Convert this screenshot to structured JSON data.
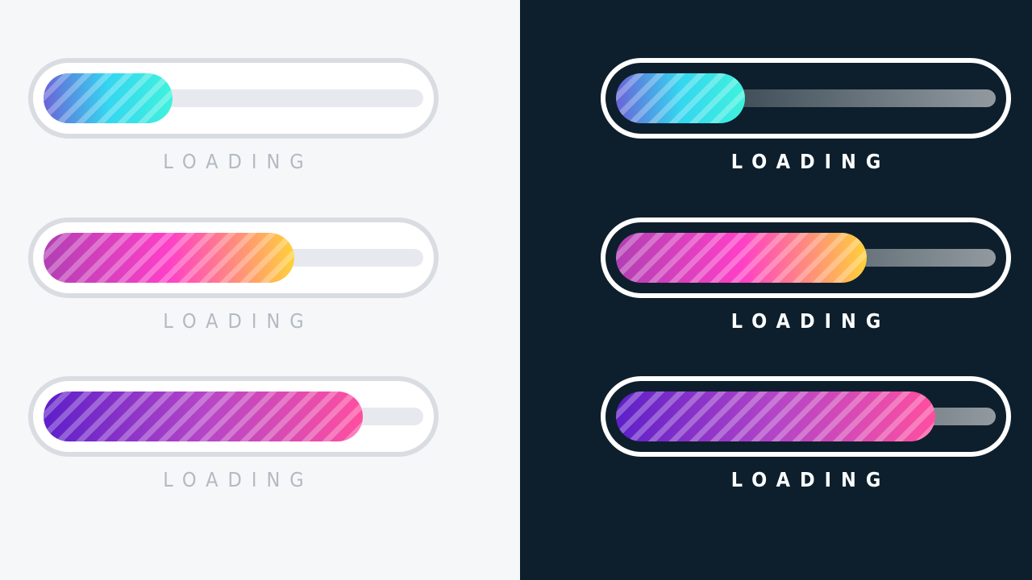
{
  "colors": {
    "light_background": "#f6f7f9",
    "dark_background": "#0d1f2c"
  },
  "panels": [
    {
      "theme": "light",
      "loaders": [
        {
          "label": "LOADING",
          "progress": 0.34,
          "gradient": [
            "#6a63d8",
            "#34d6f0",
            "#3ff2dc"
          ]
        },
        {
          "label": "LOADING",
          "progress": 0.66,
          "gradient": [
            "#b13fb3",
            "#ff3fc8",
            "#ffd13a"
          ]
        },
        {
          "label": "LOADING",
          "progress": 0.84,
          "gradient": [
            "#5d1fc9",
            "#b445c7",
            "#ff4fa0"
          ]
        }
      ]
    },
    {
      "theme": "dark",
      "loaders": [
        {
          "label": "LOADING",
          "progress": 0.34,
          "gradient": [
            "#6a63d8",
            "#34d6f0",
            "#3ff2dc"
          ]
        },
        {
          "label": "LOADING",
          "progress": 0.66,
          "gradient": [
            "#b13fb3",
            "#ff3fc8",
            "#ffd13a"
          ]
        },
        {
          "label": "LOADING",
          "progress": 0.84,
          "gradient": [
            "#5d1fc9",
            "#b445c7",
            "#ff4fa0"
          ]
        }
      ]
    }
  ]
}
